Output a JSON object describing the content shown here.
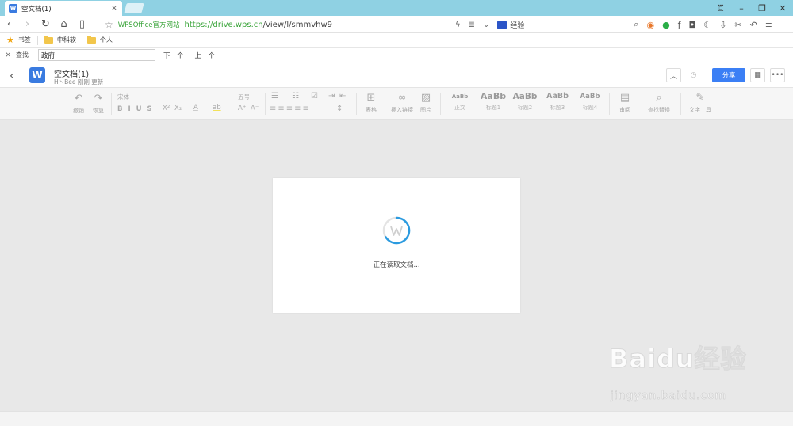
{
  "browser": {
    "tab": {
      "favicon": "W",
      "title": "空文档(1)",
      "close": "×"
    },
    "url": {
      "site_label": "WPSOffice官方网站",
      "scheme_host": "https://drive.wps.cn",
      "path": "/view/l/smmvhw9"
    },
    "search_label": "经验",
    "bookmarks": [
      {
        "label": "书签",
        "icon": "star-icon"
      },
      {
        "label": "中科软",
        "icon": "folder-icon"
      },
      {
        "label": "个人",
        "icon": "folder-icon"
      }
    ],
    "find": {
      "label": "查找",
      "value": "政府",
      "next": "下一个",
      "prev": "上一个",
      "close": "×"
    }
  },
  "doc": {
    "logo": "W",
    "name": "空文档(1)",
    "meta": "H丶Bee 刚刚 更新",
    "share_label": "分享"
  },
  "ribbon": {
    "undo": "撤销",
    "redo": "恢复",
    "font_name": "宋体",
    "font_size": "五号",
    "table": "表格",
    "link": "插入链接",
    "image": "图片",
    "styles": [
      {
        "sample": "AaBb",
        "label": "正文"
      },
      {
        "sample": "AaBb",
        "label": "标题1"
      },
      {
        "sample": "AaBb",
        "label": "标题2"
      },
      {
        "sample": "AaBb",
        "label": "标题3"
      },
      {
        "sample": "AaBb",
        "label": "标题4"
      }
    ],
    "review": "审阅",
    "find_replace": "查找替换",
    "text_tools": "文字工具"
  },
  "loading": {
    "text": "正在读取文档...",
    "accent": "#2b9be0"
  },
  "watermark": {
    "brand": "Baidu经验",
    "domain": "jingyan.baidu.com"
  },
  "colors": {
    "tabstrip": "#8fd1e3",
    "share": "#3b7ff5",
    "logo": "#3a7be0",
    "url": "#37a337"
  }
}
